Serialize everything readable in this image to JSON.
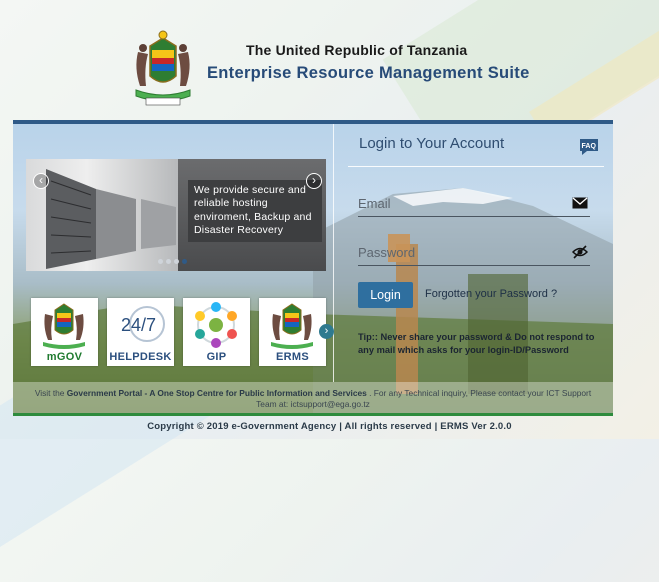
{
  "header": {
    "country": "The United Republic of Tanzania",
    "suite": "Enterprise Resource Management Suite"
  },
  "slider": {
    "caption": "We provide secure and reliable hosting enviroment, Backup and Disaster Recovery",
    "prev_icon": "chevron-left-icon",
    "next_icon": "chevron-right-icon",
    "slide_count": 4,
    "active_index": 3
  },
  "tiles": [
    {
      "label": "mGOV",
      "icon": "coat-of-arms-icon",
      "color": "#1f7a2f"
    },
    {
      "label": "HELPDESK",
      "icon": "helpdesk-24-7-icon",
      "color": "#2b4f7e"
    },
    {
      "label": "GIP",
      "icon": "gip-network-icon",
      "color": "#2b4f7e"
    },
    {
      "label": "ERMS",
      "icon": "coat-of-arms-icon",
      "color": "#2b4f7e"
    }
  ],
  "tiles_next_icon": "chevron-right-icon",
  "login": {
    "title": "Login to Your Account",
    "faq_icon": "faq-icon",
    "email_placeholder": "Email",
    "email_icon": "envelope-icon",
    "password_placeholder": "Password",
    "password_icon": "eye-slash-icon",
    "button_label": "Login",
    "forgot_label": "Forgotten your Password ?",
    "tip": "Tip:: Never share your password & Do not respond to any mail which asks for your login-ID/Password"
  },
  "footer": {
    "prefix": "Visit the ",
    "portal_link": "Government Portal - A One Stop Centre for Public Information and Services",
    "middle": " . For any Technical inquiry, Please contact your ICT Support Team at: ",
    "email": "ictsupport@ega.go.tz"
  },
  "copyright": "Copyright © 2019 e-Government Agency | All rights reserved | ERMS Ver 2.0.0",
  "colors": {
    "brand_blue": "#2f5a87",
    "brand_green": "#2e8b3d",
    "button": "#2f6f9f"
  }
}
